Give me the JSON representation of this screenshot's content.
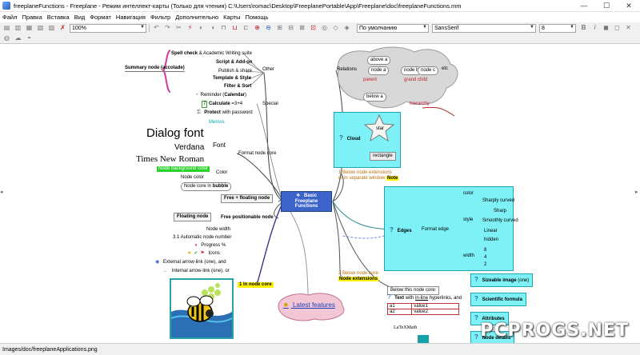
{
  "window": {
    "title": "freeplaneFunctions - Freeplane - Режим интеллект-карты (Только для чтения) C:\\Users\\romac\\Desktop\\FreeplanePortable\\App\\Freeplane\\doc\\freeplaneFunctions.mm",
    "minimize": "—",
    "maximize": "☐",
    "close": "✕"
  },
  "menu": [
    "Файл",
    "Правка",
    "Вставка",
    "Вид",
    "Формат",
    "Навигация",
    "Фильтр",
    "Дополнительно",
    "Карты",
    "Помощь"
  ],
  "toolbar": {
    "zoom": "100%",
    "style": "По умолчанию",
    "font": "SansSerif",
    "size": "8",
    "bold": "B",
    "italic": "I"
  },
  "status": {
    "text": "Images/doc/freeplaneApplications.png"
  },
  "watermark": "PCPROGS.NET",
  "map": {
    "root": "Basic Freeplane Functions",
    "left": {
      "summary": "Summary node (accolade)",
      "other": "Other",
      "spell_check": "Spell check",
      "spell_check_rest": "& Academic Writing suite",
      "script": "Script & Add-on",
      "publish": "Publish & share",
      "template": "Template & Style",
      "filter": "Filter & Sort",
      "reminder_a": "Reminder (",
      "reminder_b": "Calendar",
      "reminder_c": ")",
      "special": "Special",
      "calculate_num": "7",
      "calculate": "Calculate",
      "calc_expr": "=3+4",
      "protect_a": "Protect",
      "protect_b": "with password",
      "memos": "Memos",
      "dialog_font": "Dialog font",
      "verdana": "Verdana",
      "times": "Times New Roman",
      "font": "Font",
      "format_node_core": "Format node core",
      "node_bg_color": "Node background color",
      "node_color": "Node color",
      "color": "Color",
      "bubble_a": "Node core in ",
      "bubble_b": "bubble",
      "free_floating": "Free + floating node",
      "floating_node": "Floating node",
      "free_positionable": "Free positionable node",
      "node_width": "Node width",
      "auto_number": "3.1 Automatic node number",
      "progress": "Progress %",
      "icons": "Icons",
      "ext_arrow": "External arrow-link (one), and",
      "int_arrow": "Internal arrow-link (one), or",
      "in_node_core": "1 In node core"
    },
    "right": {
      "relations": "Relations",
      "above_a": "above a",
      "node_a": "node a",
      "node_b": "node b",
      "node_c": "node c",
      "parent": "parent",
      "grand_child": "grand child",
      "below_a": "below a",
      "etc": "etc",
      "hierarchy": "hierarchy",
      "cloud": "Cloud",
      "star": "star",
      "rectangle": "rectangle",
      "below_ext_1": "1 Below node extensions",
      "below_ext_2": "or in separate window",
      "note": "Note",
      "edges": "Edges",
      "format_edge": "Format edge",
      "e_color": "color",
      "e_style": "style",
      "e_width": "width",
      "sharply_curved": "Sharply curved",
      "sharp": "Sharp",
      "smoothly_curved": "Smoothly curved",
      "linear": "Linear",
      "hidden": "hidden",
      "w8": "8",
      "w4": "4",
      "w2": "2",
      "w1": "1",
      "below_core_2": "2 Below node core:",
      "node_extensions": "Node extensions",
      "below_this": "Below this node core:",
      "text_a": "Text",
      "text_b": "with ",
      "text_c": "in-line",
      "text_d": " hyperlinks, and",
      "a1": "a1",
      "value1": "value1",
      "a2": "a2",
      "value2": "value2",
      "latex": "LaTeXMath",
      "sizeable_image": "Sizeable image",
      "sizeable_image_tail": " (one)",
      "scientific_formula": "Scientific formula",
      "attributes": "Attributes",
      "node_details": "Node details",
      "latest_features": "Latest features"
    }
  }
}
